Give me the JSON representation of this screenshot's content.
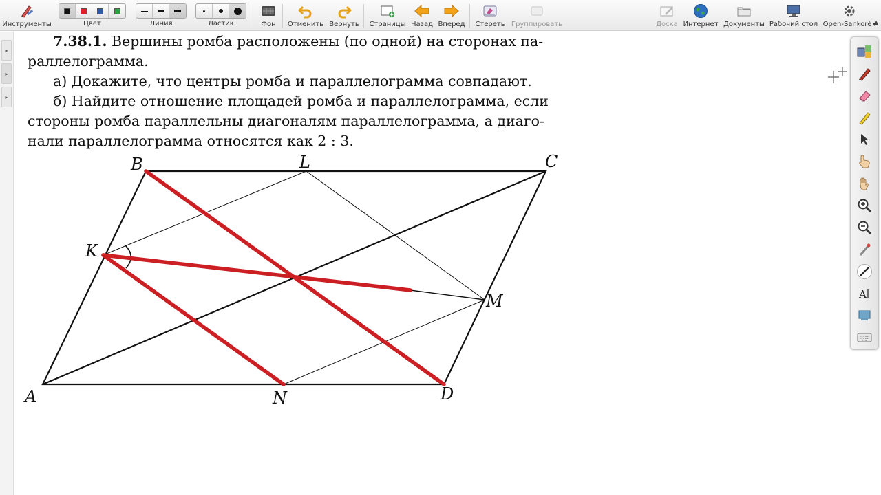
{
  "toolbar": {
    "instruments": "Инструменты",
    "color": "Цвет",
    "line": "Линия",
    "eraser": "Ластик",
    "background": "Фон",
    "undo": "Отменить",
    "redo": "Вернуть",
    "pages": "Страницы",
    "back": "Назад",
    "forward": "Вперед",
    "erase": "Стереть",
    "group": "Группировать",
    "board": "Доска",
    "internet": "Интернет",
    "documents": "Документы",
    "desktop": "Рабочий стол",
    "open_sankore": "Open-Sankoré",
    "open_sankore_arrow": "▾",
    "color_swatches": [
      "#111111",
      "#e02020",
      "#2a5ba8",
      "#2ea043"
    ],
    "icons": {
      "instruments": "pencil-ruler-icon",
      "background": "keyboard-grid-icon",
      "undo": "undo-arrow-icon",
      "redo": "redo-arrow-icon",
      "pages": "add-page-icon",
      "back": "arrow-left-icon",
      "forward": "arrow-right-icon",
      "erase": "eraser-icon",
      "group": "group-icon",
      "board": "board-pen-icon",
      "internet": "globe-icon",
      "documents": "folder-icon",
      "desktop": "monitor-icon",
      "open_sankore": "gear-icon"
    }
  },
  "problem": {
    "number": "7.38.1.",
    "line1": "Вершины ромба расположены (по одной) на сторонах па-",
    "line2": "раллелограмма.",
    "line3": "а) Докажите, что центры ромба и параллелограмма совпадают.",
    "line4": "б) Найдите отношение площадей ромба и параллелограмма, если",
    "line5": "стороны ромба параллельны диагоналям параллелограмма, а диаго-",
    "line6": "нали параллелограмма относятся как 2 : 3."
  },
  "figure": {
    "labels": {
      "A": "A",
      "B": "B",
      "C": "C",
      "D": "D",
      "K": "K",
      "L": "L",
      "M": "M",
      "N": "N"
    },
    "annotation_color": "#cc1f24"
  },
  "right_toolbar": {
    "icons": [
      "stack-icon",
      "pen-icon",
      "eraser-icon",
      "highlighter-icon",
      "pointer-icon",
      "hand-pointer-icon",
      "hand-icon",
      "zoom-in-icon",
      "zoom-out-icon",
      "laser-icon",
      "line-icon",
      "text-icon",
      "capture-icon",
      "keyboard-icon"
    ]
  }
}
